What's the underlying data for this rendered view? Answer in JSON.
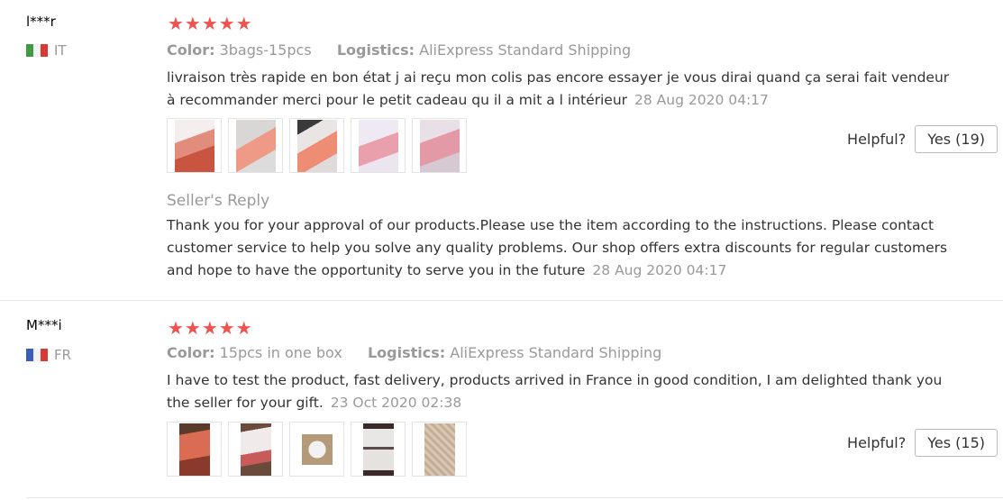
{
  "reviews": [
    {
      "user": "l***r",
      "country_code": "IT",
      "rating": "★★★★★",
      "color_label": "Color:",
      "color_value": "3bags-15pcs",
      "logistics_label": "Logistics:",
      "logistics_value": "AliExpress Standard Shipping",
      "text": "livraison très rapide en bon état j ai reçu mon colis pas encore essayer je vous dirai quand ça serai fait vendeur à recommander merci pour le petit cadeau qu il a mit a l intérieur",
      "date": "28 Aug 2020 04:17",
      "helpful_label": "Helpful?",
      "helpful_button": "Yes (19)",
      "seller_reply_title": "Seller's Reply",
      "seller_reply_text": "Thank you for your approval of our products.Please use the item according to the instructions. Please contact customer service to help you solve any quality problems. Our shop offers extra discounts for regular customers and hope to have the opportunity to serve you in the future",
      "seller_reply_date": "28 Aug 2020 04:17"
    },
    {
      "user": "M***i",
      "country_code": "FR",
      "rating": "★★★★★",
      "color_label": "Color:",
      "color_value": "15pcs in one box",
      "logistics_label": "Logistics:",
      "logistics_value": "AliExpress Standard Shipping",
      "text": "I have to test the product, fast delivery, products arrived in France in good condition, I am delighted thank you the seller for your gift.",
      "date": "23 Oct 2020 02:38",
      "helpful_label": "Helpful?",
      "helpful_button": "Yes (15)"
    }
  ],
  "colors": {
    "star": "#ef5350",
    "muted": "#999999",
    "text": "#333333",
    "divider": "#e6e6e6"
  }
}
